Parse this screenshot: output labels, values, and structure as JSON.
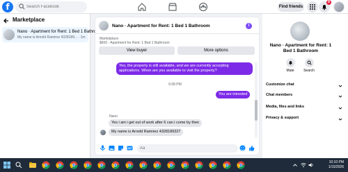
{
  "topbar": {
    "logo": "f",
    "search_placeholder": "Search Facebook",
    "find_friends": "Find friends",
    "notification_count": "8",
    "icons": [
      "facebook-logo",
      "search-icon",
      "home-icon",
      "marketplace-icon",
      "groups-icon",
      "menu-grid-icon",
      "messenger-icon",
      "bell-icon",
      "account-avatar"
    ]
  },
  "sidebar": {
    "title": "Marketplace",
    "conversation": {
      "title": "Nano · Apartment for Rent: 1 Bed 1 Bathroom",
      "subtitle": "My name is Arnold Ramirez 4328189... · 1m"
    }
  },
  "chat": {
    "title": "Nano · Apartment for Rent: 1 Bed 1 Bathroom",
    "listing_category": "Marketplace",
    "listing_price": "$600 · Apartment for Rent: 1 Bed 1 Bathroom",
    "view_buyer": "View buyer",
    "more_options": "More options",
    "messages": {
      "out1": "Yes, the property is still available, and we are currently accepting applications. When are you available to visit the property?",
      "time": "6:08 PM",
      "out2": "You are intrested",
      "sender": "Nano",
      "in1": "Yes i am i get out of work after 6 can i come by then",
      "in2": "My name is Arnold Ramirez 4328189327"
    },
    "composer_placeholder": "Aa"
  },
  "info_panel": {
    "title": "Nano · Apartment for Rent: 1 Bed 1 Bathroom",
    "mute": "Mute",
    "search": "Search",
    "rows": [
      "Customize chat",
      "Chat members",
      "Media, files and links",
      "Privacy & support"
    ]
  },
  "taskbar": {
    "time": "10:10 PM",
    "date": "1/15/2026"
  },
  "colors": {
    "brand": "#1877f2",
    "bubble_out": "#7d2ae8",
    "taskbar": "#1f2b3a"
  }
}
